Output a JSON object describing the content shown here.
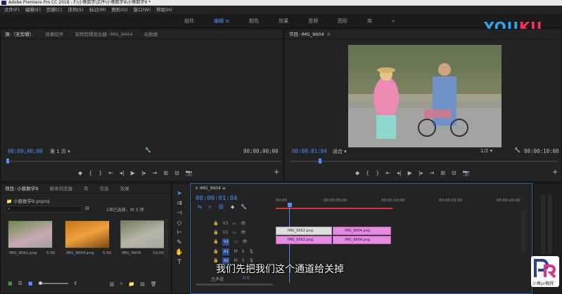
{
  "titlebar": {
    "text": "Adobe Premiere Pro CC 2018 - F:\\小蔡数学\\文件\\小蔡数学9\\小蔡数学9 *"
  },
  "menu": [
    "文件(F)",
    "编辑(E)",
    "剪辑(C)",
    "序列(S)",
    "标记(M)",
    "图形(G)",
    "窗口(W)",
    "帮助(H)"
  ],
  "workspaces": {
    "items": [
      "组件",
      "编辑",
      "颜色",
      "效果",
      "音频",
      "图形",
      "库"
    ],
    "active_index": 1,
    "more": "»"
  },
  "youku": {
    "you": "YOU",
    "ku": "KU"
  },
  "source": {
    "tabs": [
      "源:（无剪辑）",
      "效果控件",
      "音频剪辑混合器: IMG_9604",
      "元数据"
    ],
    "tc_left": "00;00;00;00",
    "page": "第 1 页",
    "tc_right": "00;00;00;00"
  },
  "program": {
    "title": "节目: IMG_9604",
    "tc": "00:00:01:04",
    "fit": "适合",
    "ratio": "1/2",
    "tc_end": "00:00:10:00"
  },
  "project": {
    "tabs": [
      "项目: 小蔡数学9",
      "媒体浏览器",
      "库",
      "信息",
      "效果"
    ],
    "file": "小蔡数学9.prproj",
    "selection": "1项已选择，共 3 项",
    "items": [
      {
        "name": "IMG_9562.png",
        "dur": "5:00"
      },
      {
        "name": "IMG_9604.png",
        "dur": "5:00"
      },
      {
        "name": "IMG_9604",
        "dur": "10:00"
      }
    ]
  },
  "timeline": {
    "seq": "IMG_9604",
    "tc": "00:00:01:04",
    "ruler": [
      "00:00",
      "00:00:05:00",
      "00:00:10:00",
      "00:00:15:00",
      "00:00:20:00"
    ],
    "tracks": {
      "v3": "V3",
      "v2": "V2",
      "v1": "V1",
      "a1": "A1",
      "a2": "A2",
      "master": "主声道",
      "master_val": "0.0",
      "m": "M",
      "s": "S"
    },
    "clips": {
      "v1a": "IMG_9562.png",
      "v1b": "IMG_9604.png",
      "v2a": "IMG_9562.png",
      "v2b": "IMG_9604.png"
    }
  },
  "subtitle": "我们先把我们这个通道给关掉",
  "prlogo": {
    "text": "小蔡pr教程"
  },
  "colors": {
    "accent": "#4d93ff",
    "clip_audio": "#e48ce0",
    "youku_blue": "#2aa8ee",
    "youku_red": "#ff2e5b"
  }
}
